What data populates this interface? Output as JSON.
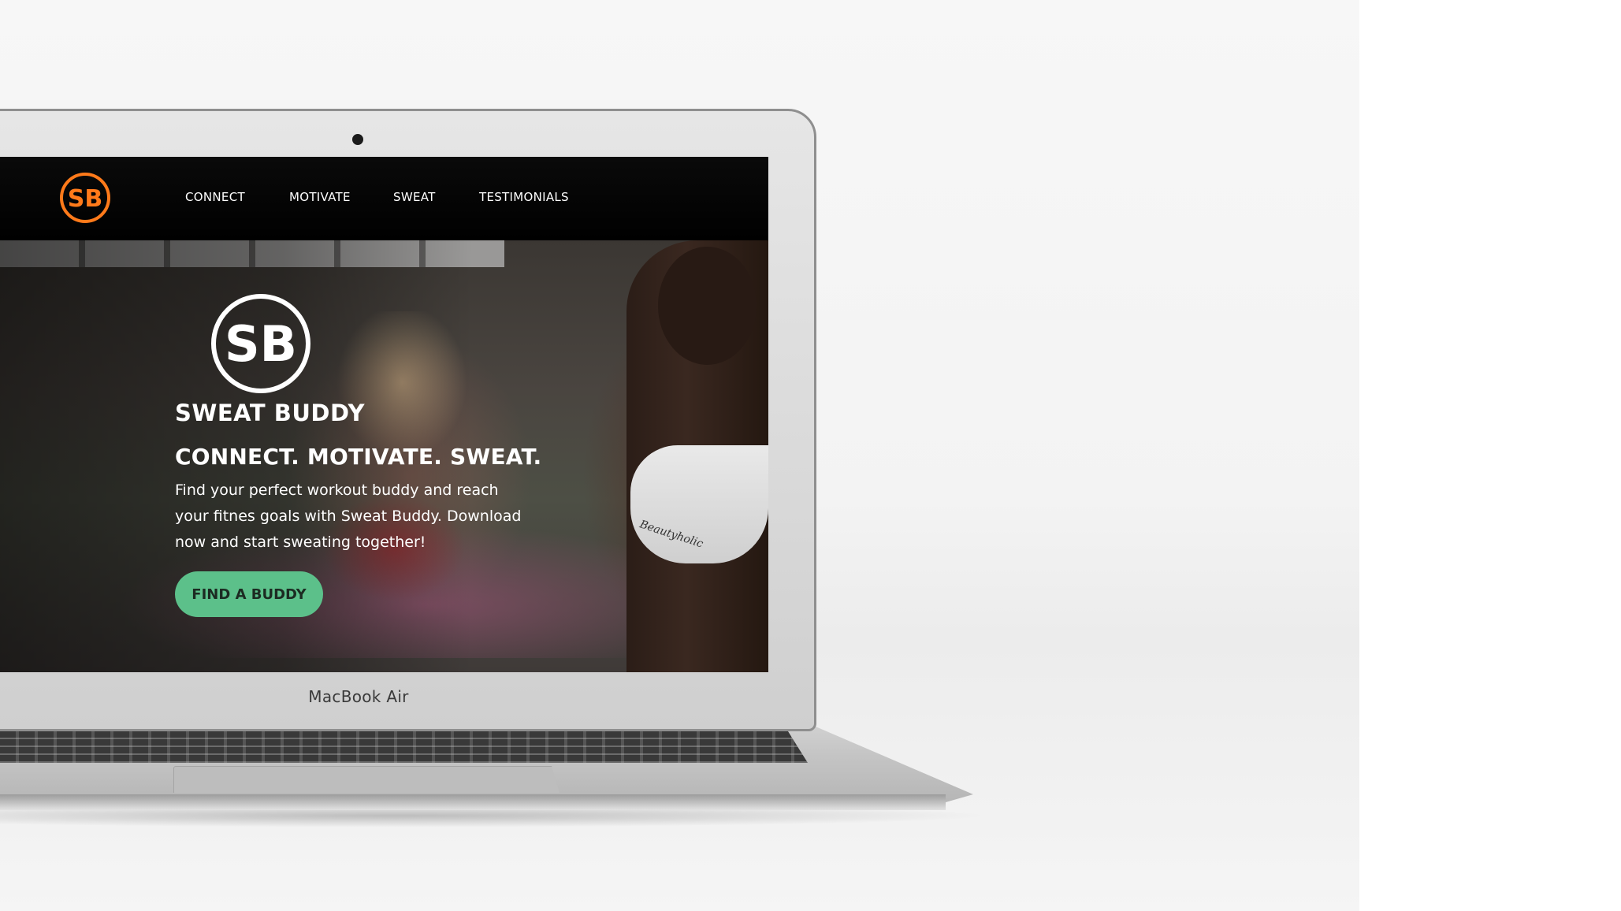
{
  "brand": {
    "logo_text": "SB",
    "name": "SWEAT BUDDY",
    "accent_color": "#ff7a1a",
    "cta_color": "#5cc08a"
  },
  "nav": {
    "items": [
      {
        "label": "CONNECT"
      },
      {
        "label": "MOTIVATE"
      },
      {
        "label": "SWEAT"
      },
      {
        "label": "TESTIMONIALS"
      }
    ]
  },
  "hero": {
    "tagline": "CONNECT. MOTIVATE. SWEAT.",
    "body": "Find your perfect workout buddy and reach your fitnes goals with Sweat Buddy. Download now and start sweating together!",
    "cta_label": "FIND A BUDDY",
    "shirt_text": "Beautyholic"
  },
  "device": {
    "model_label": "MacBook Air"
  }
}
